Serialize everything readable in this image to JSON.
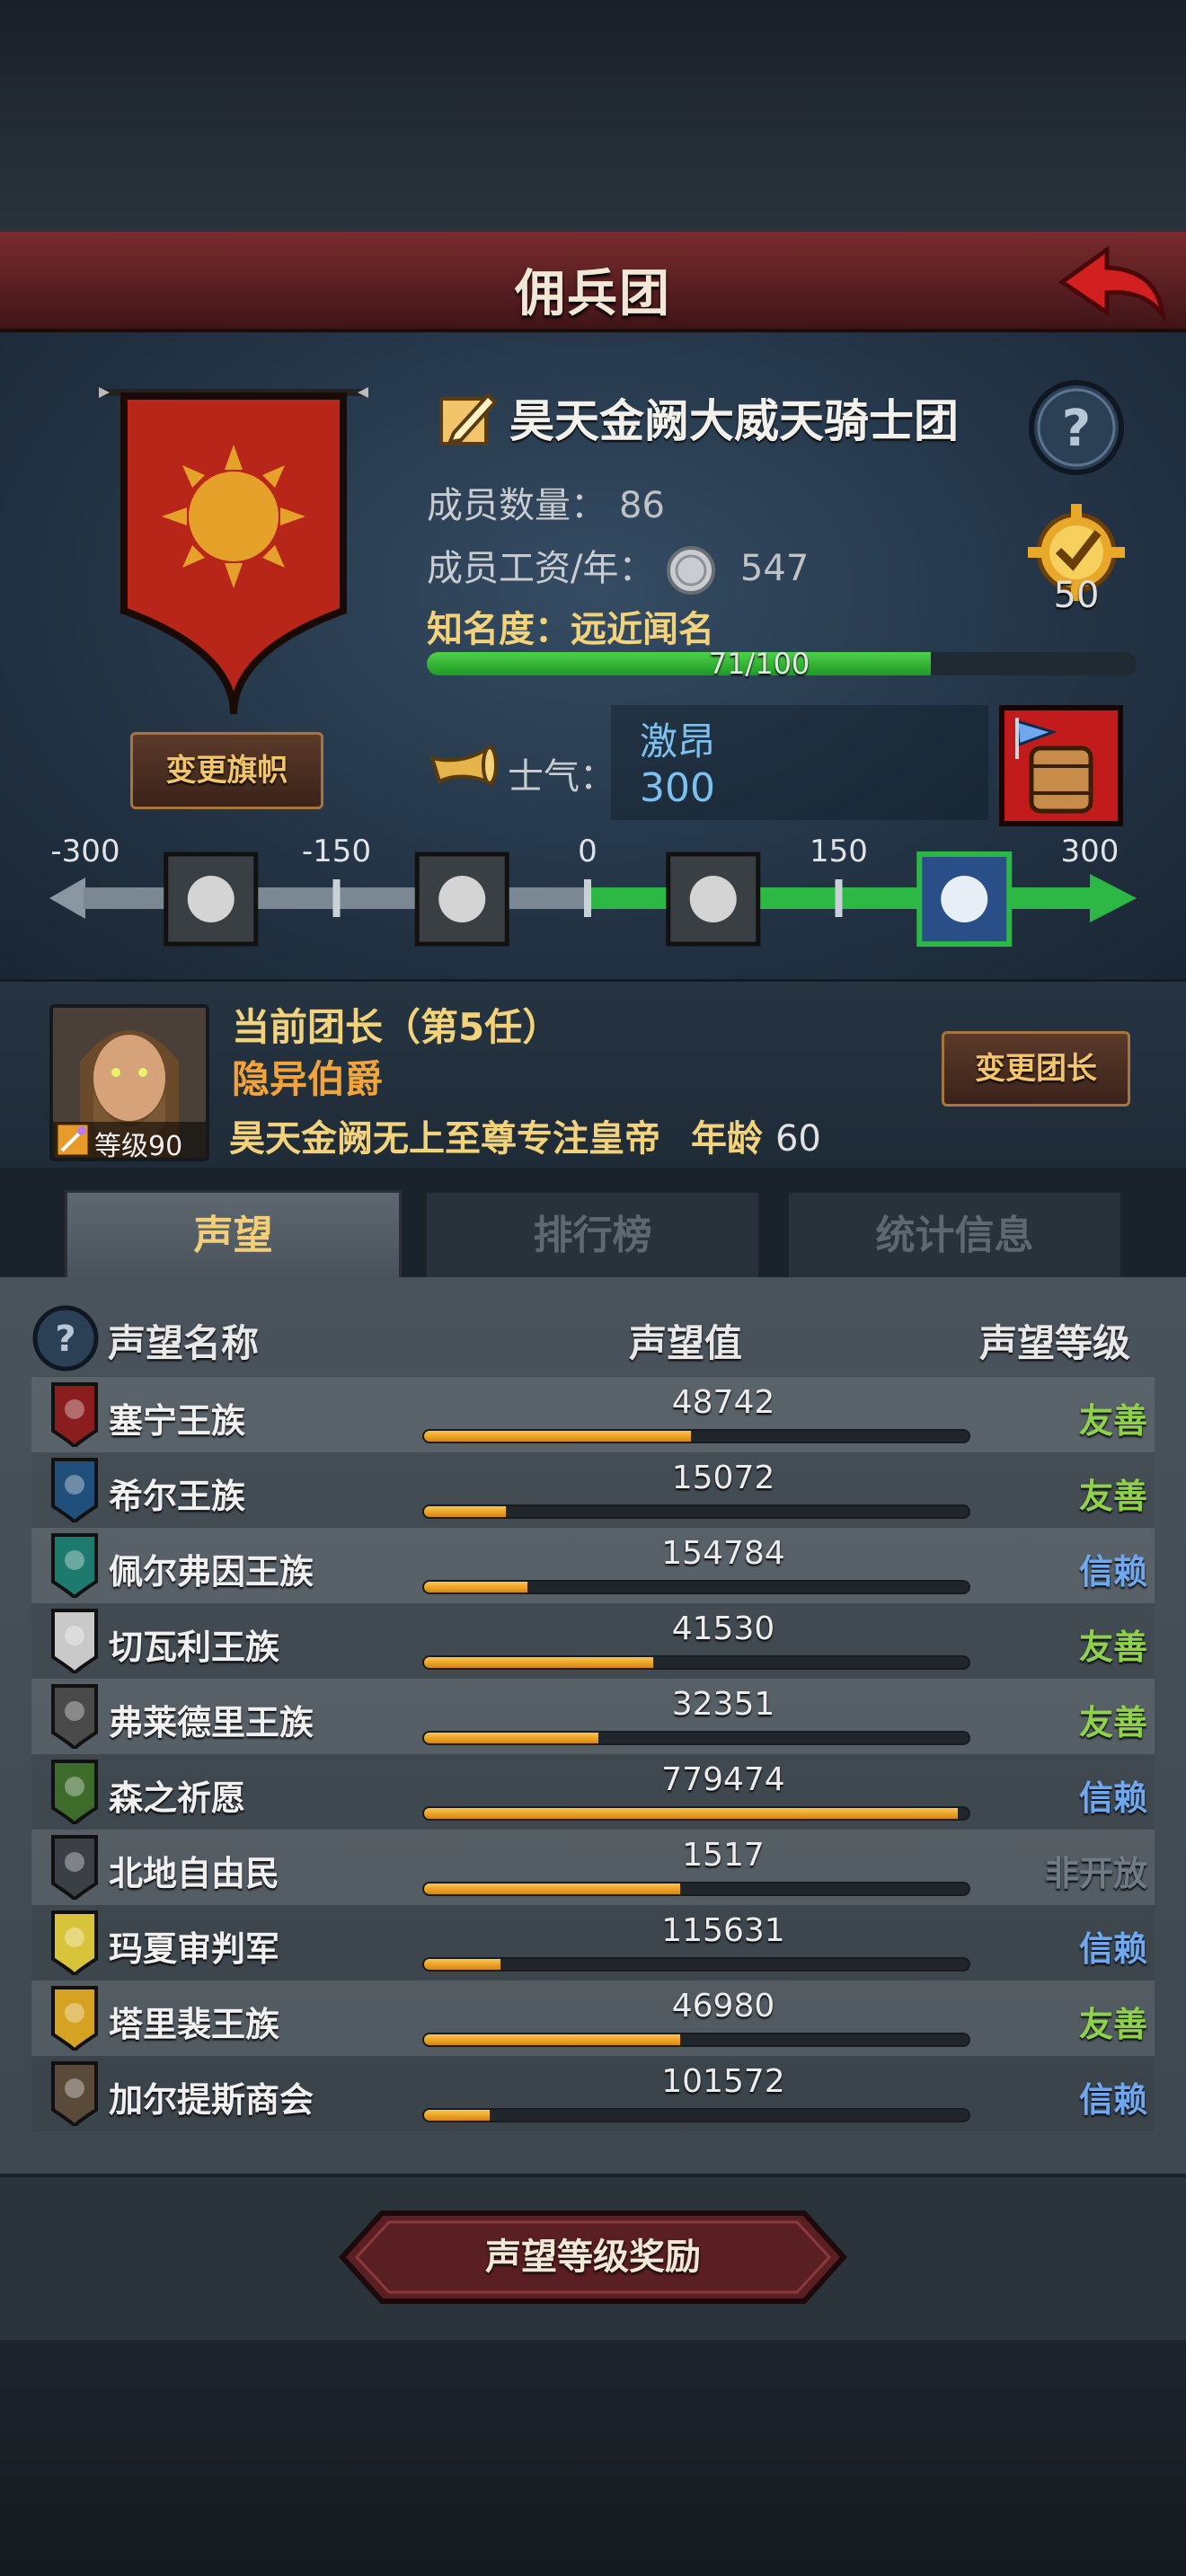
{
  "header": {
    "title": "佣兵团"
  },
  "guild": {
    "name": "昊天金阙大威天骑士团",
    "members_label": "成员数量：",
    "members_value": "86",
    "salary_label": "成员工资/年：",
    "salary_value": "547",
    "fame_label": "知名度：",
    "fame_value": "远近闻名",
    "fame_progress_text": "71/100",
    "fame_progress": 0.71,
    "medal_value": "50",
    "change_banner_label": "变更旗帜"
  },
  "morale": {
    "label": "士气：",
    "state": "激昂",
    "value": "300",
    "scale_ticks": [
      "-300",
      "-150",
      "0",
      "150",
      "300"
    ],
    "scale_value": 300
  },
  "leader": {
    "title": "当前团长（第5任）",
    "name": "隐异伯爵",
    "level_text": "等级90",
    "desc": "昊天金阙无上至尊专注皇帝",
    "age_label": "年龄",
    "age_value": "60",
    "change_leader_label": "变更团长"
  },
  "tabs": [
    {
      "label": "声望",
      "active": true
    },
    {
      "label": "排行榜",
      "active": false
    },
    {
      "label": "统计信息",
      "active": false
    }
  ],
  "reputation": {
    "col_name": "声望名称",
    "col_value": "声望值",
    "col_level": "声望等级",
    "rows": [
      {
        "name": "塞宁王族",
        "value": "48742",
        "progress": 0.49,
        "level": "友善",
        "level_color": "#8fd24a",
        "icon_color": "#8a1e1e"
      },
      {
        "name": "希尔王族",
        "value": "15072",
        "progress": 0.15,
        "level": "友善",
        "level_color": "#8fd24a",
        "icon_color": "#1f4f7a"
      },
      {
        "name": "佩尔弗因王族",
        "value": "154784",
        "progress": 0.19,
        "level": "信赖",
        "level_color": "#6fa8ee",
        "icon_color": "#1c7a6e"
      },
      {
        "name": "切瓦利王族",
        "value": "41530",
        "progress": 0.42,
        "level": "友善",
        "level_color": "#8fd24a",
        "icon_color": "#c9c9c9"
      },
      {
        "name": "弗莱德里王族",
        "value": "32351",
        "progress": 0.32,
        "level": "友善",
        "level_color": "#8fd24a",
        "icon_color": "#4a4a4a"
      },
      {
        "name": "森之祈愿",
        "value": "779474",
        "progress": 0.98,
        "level": "信赖",
        "level_color": "#6fa8ee",
        "icon_color": "#3d6b2a"
      },
      {
        "name": "北地自由民",
        "value": "1517",
        "progress": 0.47,
        "level": "非开放",
        "level_color": "#6f7c88",
        "icon_color": "#3b4047"
      },
      {
        "name": "玛夏审判军",
        "value": "115631",
        "progress": 0.14,
        "level": "信赖",
        "level_color": "#6fa8ee",
        "icon_color": "#d8c43a"
      },
      {
        "name": "塔里裴王族",
        "value": "46980",
        "progress": 0.47,
        "level": "友善",
        "level_color": "#8fd24a",
        "icon_color": "#d6a222"
      },
      {
        "name": "加尔提斯商会",
        "value": "101572",
        "progress": 0.12,
        "level": "信赖",
        "level_color": "#6fa8ee",
        "icon_color": "#5a4a3a"
      }
    ]
  },
  "bottom": {
    "reward_button_label": "声望等级奖励"
  },
  "colors": {
    "header_red": "#6a2427",
    "gold_text": "#f2d27a",
    "green_level": "#8fd24a",
    "blue_level": "#6fa8ee",
    "morale_green": "#2db846"
  },
  "icons": [
    "back-arrow-icon",
    "edit-icon",
    "help-icon",
    "silver-coin-icon",
    "medal-icon",
    "horn-icon",
    "drum-icon",
    "eye-icon",
    "despair-icon",
    "calm-icon",
    "victory-icon"
  ]
}
